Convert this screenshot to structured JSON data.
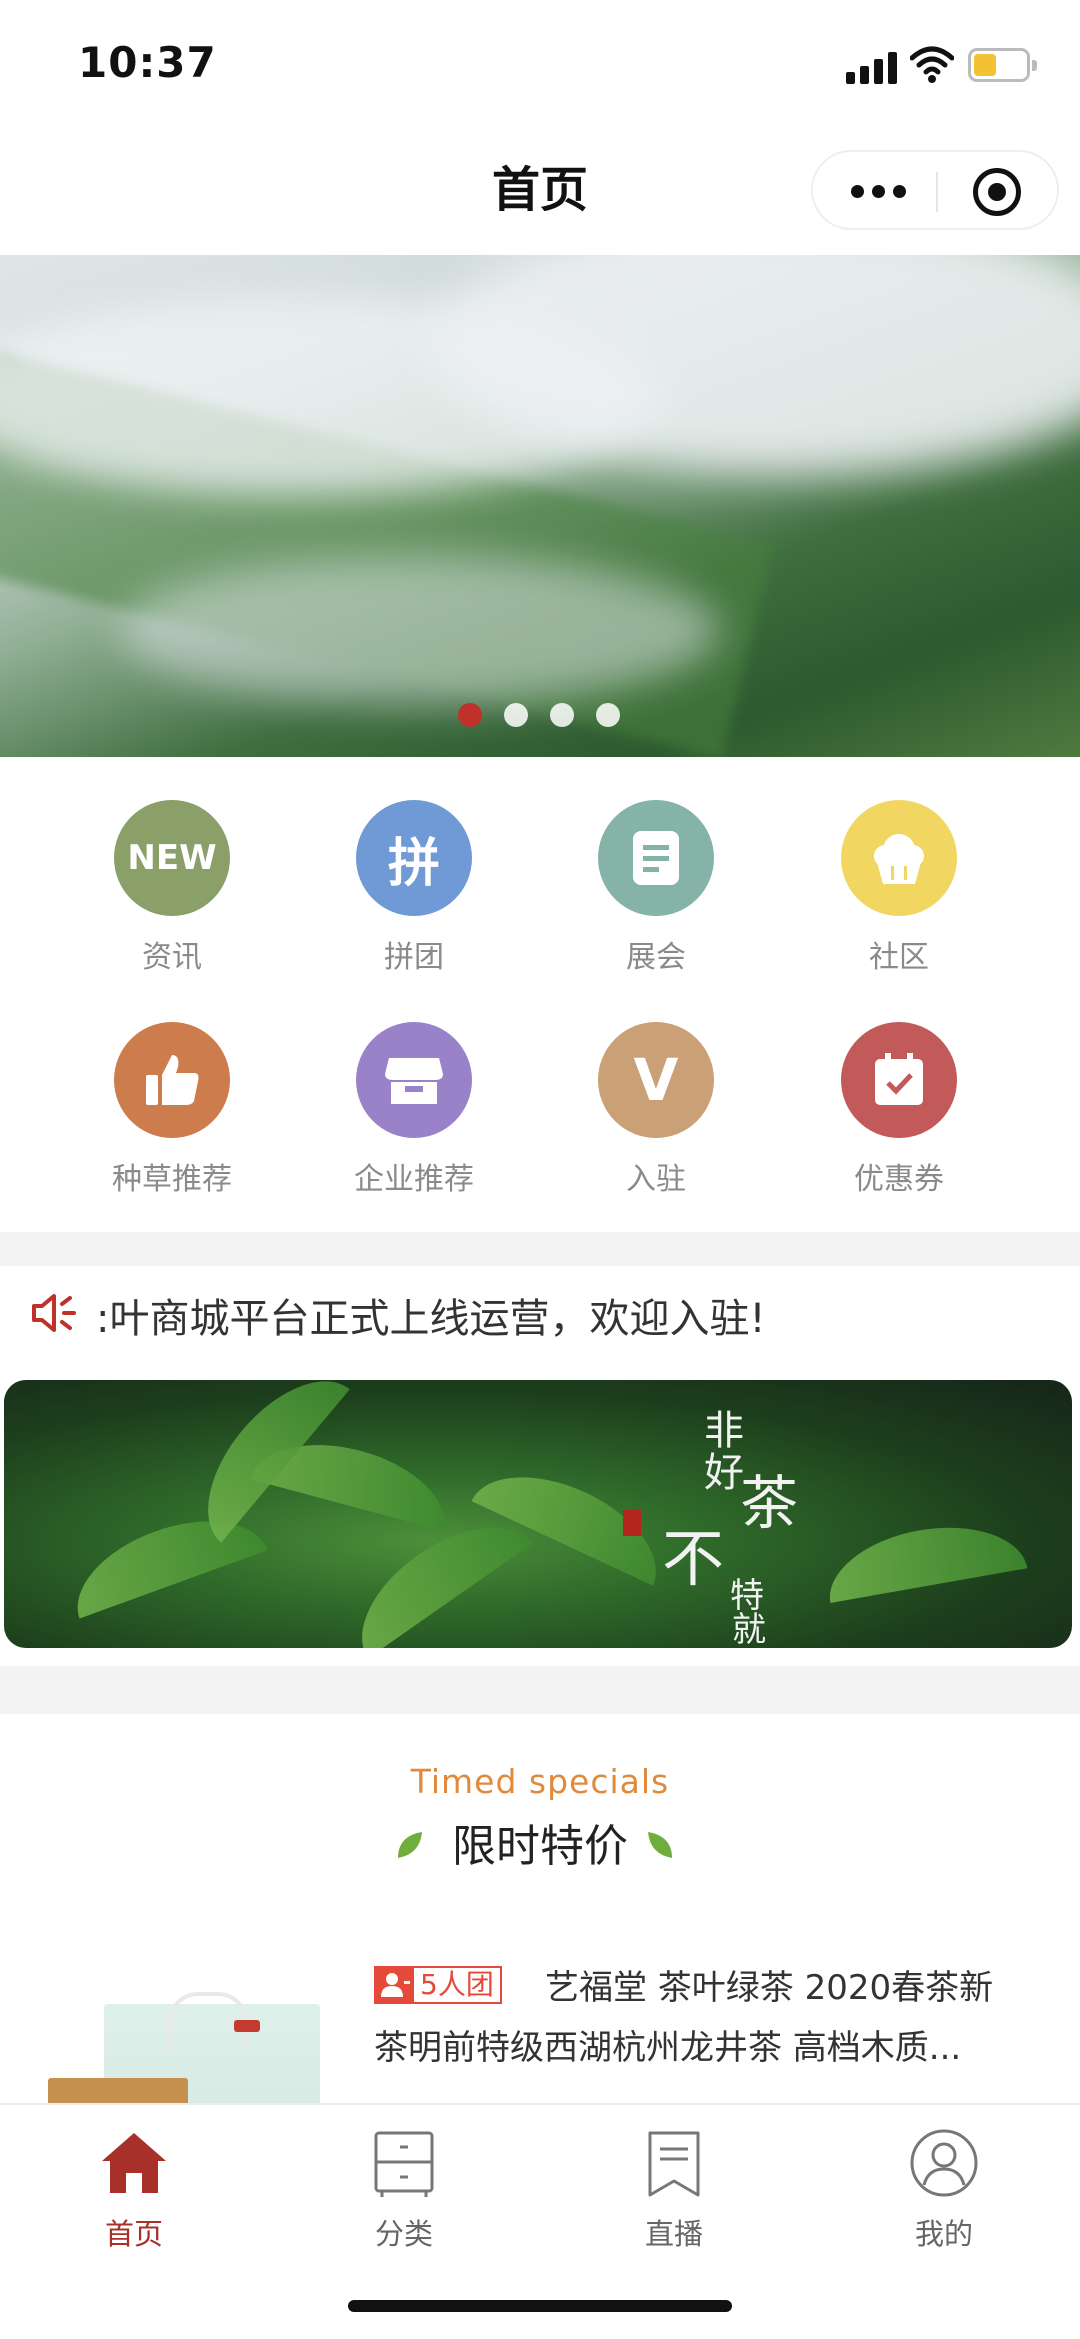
{
  "status_bar": {
    "time": "10:37"
  },
  "nav": {
    "title": "首页"
  },
  "hero": {
    "slide_count": 4,
    "active_index": 0
  },
  "grid": [
    {
      "label": "资讯",
      "icon": "new-badge-icon",
      "text": "NEW",
      "color": "#8aa068"
    },
    {
      "label": "拼团",
      "icon": "group-buy-icon",
      "text": "拼",
      "color": "#6f9ad6"
    },
    {
      "label": "展会",
      "icon": "document-icon",
      "text": "",
      "color": "#86b3a8"
    },
    {
      "label": "社区",
      "icon": "cupcake-icon",
      "text": "",
      "color": "#f1d761"
    },
    {
      "label": "种草推荐",
      "icon": "thumbs-up-icon",
      "text": "",
      "color": "#cd7c4d"
    },
    {
      "label": "企业推荐",
      "icon": "store-icon",
      "text": "",
      "color": "#9a82c9"
    },
    {
      "label": "入驻",
      "icon": "v-badge-icon",
      "text": "V",
      "color": "#caa176"
    },
    {
      "label": "优惠券",
      "icon": "calendar-check-icon",
      "text": "",
      "color": "#c25a59"
    }
  ],
  "notice": {
    "text": ":叶商城平台正式上线运营，欢迎入驻!",
    "icon": "speaker-icon",
    "icon_color": "#c0312b"
  },
  "tea_banner": {
    "chars": [
      "非",
      "好",
      "茶",
      "不",
      "特",
      "就"
    ]
  },
  "specials": {
    "en": "Timed specials",
    "zh": "限时特价"
  },
  "product": {
    "badge": "5人团",
    "title_line1": "艺福堂 茶叶绿茶 2020春茶新",
    "title_line2": "茶明前特级西湖杭州龙井茶 高档木质..."
  },
  "tabbar": [
    {
      "label": "首页",
      "icon": "home-icon",
      "active": true
    },
    {
      "label": "分类",
      "icon": "drawer-icon",
      "active": false
    },
    {
      "label": "直播",
      "icon": "bookmark-icon",
      "active": false
    },
    {
      "label": "我的",
      "icon": "user-icon",
      "active": false
    }
  ],
  "colors": {
    "accent": "#a8302b",
    "specials_en": "#e08a3e",
    "badge": "#e4493a"
  }
}
